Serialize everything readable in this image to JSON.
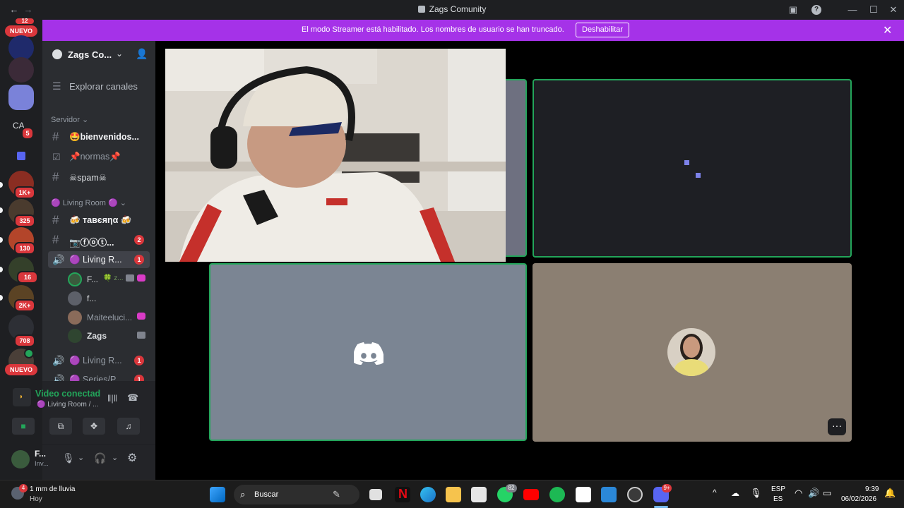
{
  "window": {
    "title": "Zags Comunity"
  },
  "banner": {
    "message": "El modo Streamer está habilitado. Los nombres de usuario se han truncado.",
    "button": "Deshabilitar"
  },
  "rail": {
    "top_badge": "12",
    "nuevo_top": "NUEVO",
    "nuevo_bottom": "NUEVO",
    "ca_label": "CA",
    "ca_badge": "5",
    "badges": [
      "1K+",
      "325",
      "130",
      "16",
      "2K+",
      "708"
    ]
  },
  "server": {
    "name": "Zags Co...",
    "explore": "Explorar canales",
    "category_server": "Servidor",
    "category_living": "🟣 Living Room 🟣",
    "channels": [
      {
        "label": "🤩bienvenidos...",
        "type": "text"
      },
      {
        "label": "📌normas📌",
        "type": "rules"
      },
      {
        "label": "☠spam☠",
        "type": "text"
      },
      {
        "label": "🍻 тавєяηα 🍻",
        "type": "text"
      },
      {
        "label": "📷ⓕⓞⓣ...",
        "type": "text",
        "count": "2"
      },
      {
        "label": "🟣 Living R...",
        "type": "voice",
        "count": "1"
      },
      {
        "label": "🟣 Living R...",
        "type": "voice",
        "count": "1"
      },
      {
        "label": "🟣 Series/P...",
        "type": "voice",
        "count": "1"
      }
    ],
    "voice_users": [
      {
        "name": "F...",
        "extra": "🍀 z..."
      },
      {
        "name": "f..."
      },
      {
        "name": "Maiteeluci..."
      },
      {
        "name": "Zags"
      }
    ]
  },
  "voice_panel": {
    "status": "Video conectad",
    "channel": "🟣 Living Room / ..."
  },
  "user_panel": {
    "name": "F...",
    "status": "Inv..."
  },
  "taskbar": {
    "weather_badge": "4",
    "weather_line1": "1 mm de lluvia",
    "weather_line2": "Hoy",
    "search": "Buscar",
    "whatsapp_badge": "82",
    "discord_badge": "9+",
    "lang1": "ESP",
    "lang2": "ES",
    "time": "9:39",
    "date": "06/02/2026"
  },
  "colors": {
    "banner": "#a532e8",
    "speaking": "#23a55a",
    "badge": "#da373c",
    "tile_gray": "#7b8593",
    "tile_beige": "#8b7f72",
    "tile_dark": "#1e1f24"
  }
}
